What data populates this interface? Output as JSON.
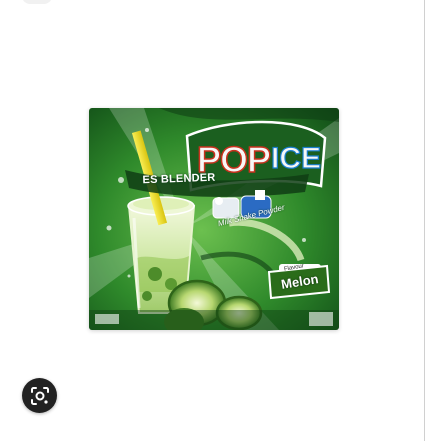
{
  "product": {
    "brand": "POP ICE",
    "series": "ES BLENDER",
    "line": "Milk Shake Powder",
    "flavour_tag": "Flavour",
    "flavour": "Melon"
  },
  "icons": {
    "lens_button": "google-lens-icon",
    "top_element": "partial-circle-icon"
  },
  "colors": {
    "pack_green": "#2f8a2b",
    "pack_dark_green": "#155c1c",
    "melon_light": "#cfe8a6",
    "straw_yellow": "#f4e21b",
    "lens_button_bg": "#222222"
  }
}
